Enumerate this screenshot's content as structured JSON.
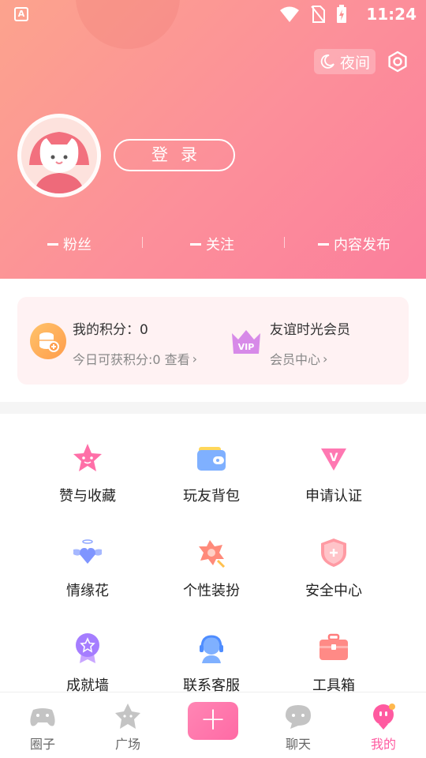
{
  "status_bar": {
    "time": "11:24",
    "app_badge": "A"
  },
  "header": {
    "night_mode_label": "夜间",
    "login_label": "登录",
    "stats": [
      {
        "value": "—",
        "label": "粉丝"
      },
      {
        "value": "—",
        "label": "关注"
      },
      {
        "value": "—",
        "label": "内容发布"
      }
    ]
  },
  "card": {
    "points_title": "我的积分：0",
    "points_sub": "今日可获积分:0 查看",
    "vip_title": "友谊时光会员",
    "vip_sub": "会员中心"
  },
  "grid": [
    {
      "label": "赞与收藏",
      "icon": "star-face-icon"
    },
    {
      "label": "玩友背包",
      "icon": "wallet-icon"
    },
    {
      "label": "申请认证",
      "icon": "v-badge-icon"
    },
    {
      "label": "情缘花",
      "icon": "winged-heart-icon"
    },
    {
      "label": "个性装扮",
      "icon": "flower-brush-icon"
    },
    {
      "label": "安全中心",
      "icon": "shield-icon"
    },
    {
      "label": "成就墙",
      "icon": "medal-icon"
    },
    {
      "label": "联系客服",
      "icon": "headset-icon"
    },
    {
      "label": "工具箱",
      "icon": "toolbox-icon"
    }
  ],
  "tabbar": {
    "tabs": [
      {
        "label": "圈子",
        "icon": "gamepad-icon"
      },
      {
        "label": "广场",
        "icon": "star-tab-icon"
      },
      {
        "label": "聊天",
        "icon": "chat-bubble-icon"
      },
      {
        "label": "我的",
        "icon": "profile-mascot-icon",
        "active": true
      }
    ],
    "plus_label": "+"
  },
  "colors": {
    "header_start": "#fca38d",
    "header_end": "#fb7f9c",
    "accent": "#ff5aa0",
    "card_bg": "#fff2f3"
  }
}
